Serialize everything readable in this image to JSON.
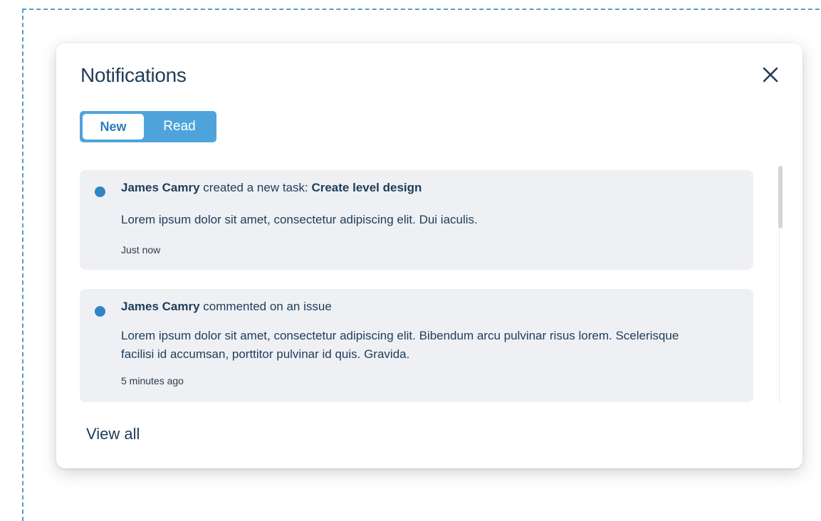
{
  "panel": {
    "title": "Notifications",
    "close_icon": "close-icon"
  },
  "tabs": {
    "new_label": "New",
    "read_label": "Read",
    "active": "New"
  },
  "notifications": [
    {
      "actor": "James Camry",
      "action": " created a new task: ",
      "target": "Create level design",
      "body": "Lorem ipsum dolor sit amet, consectetur adipiscing elit. Dui iaculis.",
      "time": "Just now",
      "unread": true
    },
    {
      "actor": "James Camry",
      "action": " commented on an issue",
      "target": "",
      "body": "Lorem ipsum dolor sit amet, consectetur adipiscing elit. Bibendum arcu pulvinar risus lorem. Scelerisque facilisi id accumsan, porttitor pulvinar id quis. Gravida.",
      "time": "5 minutes ago",
      "unread": true
    }
  ],
  "footer": {
    "view_all_label": "View all"
  },
  "colors": {
    "accent": "#4ea4da",
    "unread_dot": "#2f86c6",
    "text": "#1f3c58",
    "card_bg": "#eef0f4",
    "frame_dash": "#4e9fcf"
  }
}
